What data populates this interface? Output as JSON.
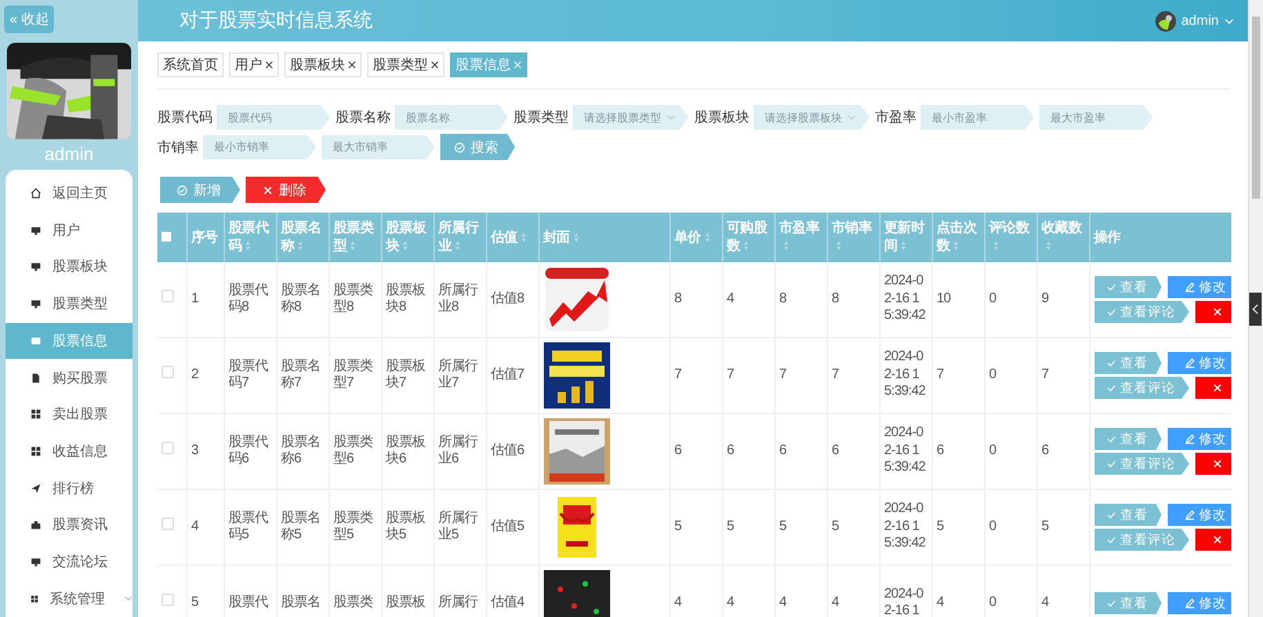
{
  "sidebar": {
    "collapse_button": "« 收起",
    "user_name": "admin",
    "avatar": {
      "kind": "picture"
    },
    "items": [
      {
        "label": "返回主页",
        "selected": false
      },
      {
        "label": "用户",
        "selected": false
      },
      {
        "label": "股票板块",
        "selected": false
      },
      {
        "label": "股票类型",
        "selected": false
      },
      {
        "label": "股票信息",
        "selected": true
      },
      {
        "label": "购买股票",
        "selected": false
      },
      {
        "label": "卖出股票",
        "selected": false
      },
      {
        "label": "收益信息",
        "selected": false
      },
      {
        "label": "排行榜",
        "selected": false
      },
      {
        "label": "股票资讯",
        "selected": false
      },
      {
        "label": "交流论坛",
        "selected": false
      },
      {
        "label": "系统管理",
        "selected": false,
        "expandable": true
      }
    ]
  },
  "header": {
    "title": "对于股票实时信息系统",
    "user": "admin"
  },
  "tabs": [
    {
      "label": "系统首页",
      "closable": false,
      "selected": false
    },
    {
      "label": "用户",
      "closable": true,
      "selected": false
    },
    {
      "label": "股票板块",
      "closable": true,
      "selected": false
    },
    {
      "label": "股票类型",
      "closable": true,
      "selected": false
    },
    {
      "label": "股票信息",
      "closable": true,
      "selected": true
    }
  ],
  "search": {
    "fields": [
      {
        "label": "股票代码",
        "inputs": [
          {
            "placeholder": "股票代码",
            "kind": "text"
          }
        ]
      },
      {
        "label": "股票名称",
        "inputs": [
          {
            "placeholder": "股票名称",
            "kind": "text"
          }
        ]
      },
      {
        "label": "股票类型",
        "inputs": [
          {
            "placeholder": "请选择股票类型",
            "kind": "select"
          }
        ]
      },
      {
        "label": "股票板块",
        "inputs": [
          {
            "placeholder": "请选择股票板块",
            "kind": "select"
          }
        ]
      },
      {
        "label": "市盈率",
        "inputs": [
          {
            "placeholder": "最小市盈率",
            "kind": "text"
          },
          {
            "placeholder": "最大市盈率",
            "kind": "text"
          }
        ]
      },
      {
        "label": "市销率",
        "inputs": [
          {
            "placeholder": "最小市销率",
            "kind": "text"
          },
          {
            "placeholder": "最大市销率",
            "kind": "text"
          }
        ]
      }
    ],
    "button": "搜索"
  },
  "toolbar": [
    {
      "label": "新增",
      "kind": "add"
    },
    {
      "label": "删除",
      "kind": "delete"
    }
  ],
  "table": {
    "header_checked": false,
    "columns": [
      {
        "label": "序号",
        "sortable": false
      },
      {
        "label": "股票代码",
        "sortable": true
      },
      {
        "label": "股票名称",
        "sortable": true
      },
      {
        "label": "股票类型",
        "sortable": true
      },
      {
        "label": "股票板块",
        "sortable": true
      },
      {
        "label": "所属行业",
        "sortable": true
      },
      {
        "label": "估值",
        "sortable": true
      },
      {
        "label": "封面",
        "sortable": true
      },
      {
        "label": "单价",
        "sortable": true
      },
      {
        "label": "可购股数",
        "sortable": true
      },
      {
        "label": "市盈率",
        "sortable": true
      },
      {
        "label": "市销率",
        "sortable": true
      },
      {
        "label": "更新时间",
        "sortable": true
      },
      {
        "label": "点击次数",
        "sortable": true
      },
      {
        "label": "评论数",
        "sortable": true
      },
      {
        "label": "收藏数",
        "sortable": true
      },
      {
        "label": "操作",
        "sortable": false
      }
    ],
    "rows": [
      {
        "selected": false,
        "cells": [
          "1",
          "股票代码8",
          "股票名称8",
          "股票类型8",
          "股票板块8",
          "所属行业8",
          "估值8"
        ],
        "cover": {
          "kind": "picture"
        },
        "cells2": [
          "8",
          "4",
          "8",
          "8",
          "2024-02-16 15:39:42",
          "10",
          "0",
          "9"
        ],
        "actions": [
          {
            "label": "查看",
            "kind": "view"
          },
          {
            "label": "修改",
            "kind": "edit"
          },
          {
            "label": "查看评论",
            "kind": "view"
          },
          {
            "kind": "delete"
          }
        ]
      },
      {
        "selected": false,
        "cells": [
          "2",
          "股票代码7",
          "股票名称7",
          "股票类型7",
          "股票板块7",
          "所属行业7",
          "估值7"
        ],
        "cover": {
          "kind": "picture"
        },
        "cells2": [
          "7",
          "7",
          "7",
          "7",
          "2024-02-16 15:39:42",
          "7",
          "0",
          "7"
        ],
        "actions": [
          {
            "label": "查看",
            "kind": "view"
          },
          {
            "label": "修改",
            "kind": "edit"
          },
          {
            "label": "查看评论",
            "kind": "view"
          },
          {
            "kind": "delete"
          }
        ]
      },
      {
        "selected": false,
        "cells": [
          "3",
          "股票代码6",
          "股票名称6",
          "股票类型6",
          "股票板块6",
          "所属行业6",
          "估值6"
        ],
        "cover": {
          "kind": "picture"
        },
        "cells2": [
          "6",
          "6",
          "6",
          "6",
          "2024-02-16 15:39:42",
          "6",
          "0",
          "6"
        ],
        "actions": [
          {
            "label": "查看",
            "kind": "view"
          },
          {
            "label": "修改",
            "kind": "edit"
          },
          {
            "label": "查看评论",
            "kind": "view"
          },
          {
            "kind": "delete"
          }
        ]
      },
      {
        "selected": false,
        "cells": [
          "4",
          "股票代码5",
          "股票名称5",
          "股票类型5",
          "股票板块5",
          "所属行业5",
          "估值5"
        ],
        "cover": {
          "kind": "picture"
        },
        "cells2": [
          "5",
          "5",
          "5",
          "5",
          "2024-02-16 15:39:42",
          "5",
          "0",
          "5"
        ],
        "actions": [
          {
            "label": "查看",
            "kind": "view"
          },
          {
            "label": "修改",
            "kind": "edit"
          },
          {
            "label": "查看评论",
            "kind": "view"
          },
          {
            "kind": "delete"
          }
        ]
      },
      {
        "selected": false,
        "cells": [
          "5",
          "股票代",
          "股票名",
          "股票类",
          "股票板",
          "所属行",
          "估值4"
        ],
        "cover": {
          "kind": "picture"
        },
        "cells2": [
          "4",
          "4",
          "4",
          "4",
          "2024-02-16 1",
          "4",
          "0",
          "4"
        ],
        "actions": [
          {
            "label": "查看",
            "kind": "view"
          },
          {
            "label": "修改",
            "kind": "edit"
          }
        ]
      }
    ]
  }
}
